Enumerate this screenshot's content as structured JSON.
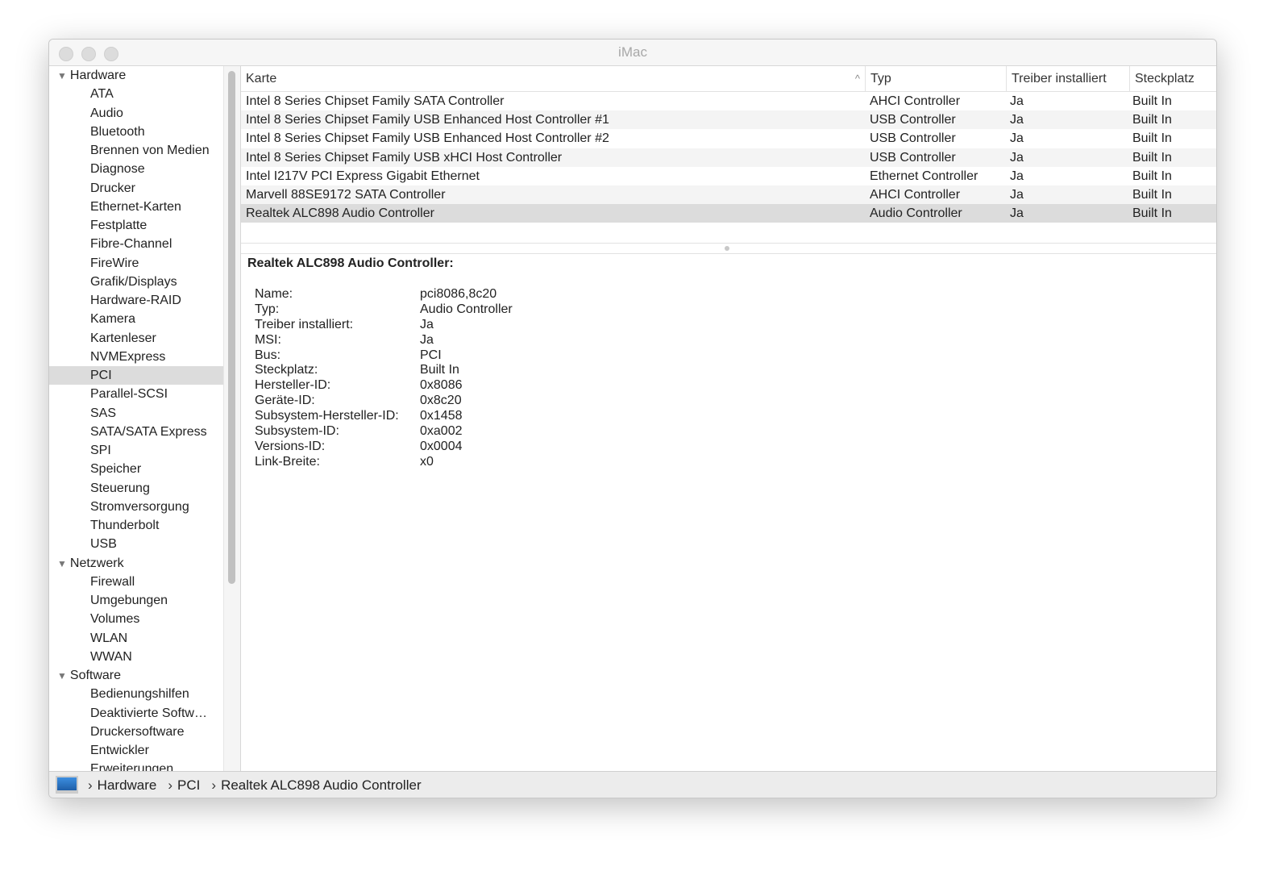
{
  "window": {
    "title": "iMac"
  },
  "sidebar": {
    "groups": [
      {
        "label": "Hardware",
        "items": [
          "ATA",
          "Audio",
          "Bluetooth",
          "Brennen von Medien",
          "Diagnose",
          "Drucker",
          "Ethernet-Karten",
          "Festplatte",
          "Fibre-Channel",
          "FireWire",
          "Grafik/Displays",
          "Hardware-RAID",
          "Kamera",
          "Kartenleser",
          "NVMExpress",
          "PCI",
          "Parallel-SCSI",
          "SAS",
          "SATA/SATA Express",
          "SPI",
          "Speicher",
          "Steuerung",
          "Stromversorgung",
          "Thunderbolt",
          "USB"
        ]
      },
      {
        "label": "Netzwerk",
        "items": [
          "Firewall",
          "Umgebungen",
          "Volumes",
          "WLAN",
          "WWAN"
        ]
      },
      {
        "label": "Software",
        "items": [
          "Bedienungshilfen",
          "Deaktivierte Softw…",
          "Druckersoftware",
          "Entwickler",
          "Erweiterungen"
        ]
      }
    ],
    "selected": "PCI"
  },
  "table": {
    "columns": [
      "Karte",
      "Typ",
      "Treiber installiert",
      "Steckplatz"
    ],
    "sort_indicator": "^",
    "rows": [
      [
        "Intel 8 Series Chipset Family SATA Controller",
        "AHCI Controller",
        "Ja",
        "Built In"
      ],
      [
        "Intel 8 Series Chipset Family USB Enhanced Host Controller #1",
        "USB Controller",
        "Ja",
        "Built In"
      ],
      [
        "Intel 8 Series Chipset Family USB Enhanced Host Controller #2",
        "USB Controller",
        "Ja",
        "Built In"
      ],
      [
        "Intel 8 Series Chipset Family USB xHCI Host Controller",
        "USB Controller",
        "Ja",
        "Built In"
      ],
      [
        "Intel I217V PCI Express Gigabit Ethernet",
        "Ethernet Controller",
        "Ja",
        "Built In"
      ],
      [
        "Marvell 88SE9172 SATA Controller",
        "AHCI Controller",
        "Ja",
        "Built In"
      ],
      [
        "Realtek ALC898 Audio Controller",
        "Audio Controller",
        "Ja",
        "Built In"
      ]
    ],
    "selected_index": 6
  },
  "detail": {
    "title": "Realtek ALC898 Audio Controller:",
    "fields": [
      [
        "Name:",
        "pci8086,8c20"
      ],
      [
        "Typ:",
        "Audio Controller"
      ],
      [
        "Treiber installiert:",
        "Ja"
      ],
      [
        "MSI:",
        "Ja"
      ],
      [
        "Bus:",
        "PCI"
      ],
      [
        "Steckplatz:",
        "Built In"
      ],
      [
        "Hersteller-ID:",
        "0x8086"
      ],
      [
        "Geräte-ID:",
        "0x8c20"
      ],
      [
        "Subsystem-Hersteller-ID:",
        "0x1458"
      ],
      [
        "Subsystem-ID:",
        "0xa002"
      ],
      [
        "Versions-ID:",
        "0x0004"
      ],
      [
        "Link-Breite:",
        "x0"
      ]
    ]
  },
  "pathbar": {
    "crumbs": [
      "Hardware",
      "PCI",
      "Realtek ALC898 Audio Controller"
    ]
  }
}
